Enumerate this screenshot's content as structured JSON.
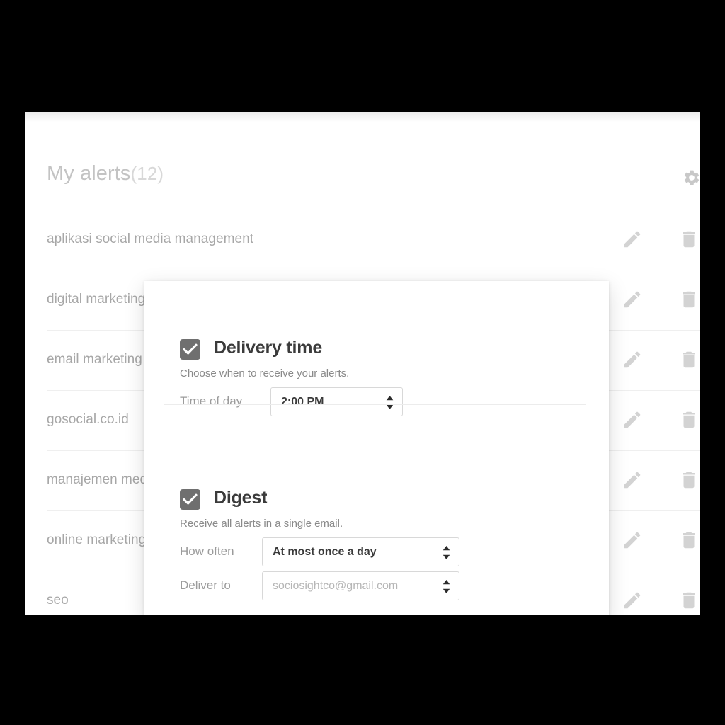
{
  "page": {
    "title_main": "My alerts",
    "title_count": "(12)",
    "settings_icon": "gear-icon",
    "edit_icon": "pencil-icon",
    "delete_icon": "trash-icon"
  },
  "alerts": [
    {
      "name": "aplikasi social media management"
    },
    {
      "name": "digital marketing"
    },
    {
      "name": "email marketing"
    },
    {
      "name": "gosocial.co.id"
    },
    {
      "name": "manajemen media sosial"
    },
    {
      "name": "online marketing"
    },
    {
      "name": "seo"
    }
  ],
  "modal": {
    "delivery_time": {
      "title": "Delivery time",
      "description": "Choose when to receive your alerts.",
      "checked": true,
      "field_label": "Time of day",
      "value": "2:00 PM"
    },
    "digest": {
      "title": "Digest",
      "description": "Receive all alerts in a single email.",
      "checked": true,
      "how_often_label": "How often",
      "how_often_value": "At most once a day",
      "deliver_to_label": "Deliver to",
      "deliver_to_value": "sociosightco@gmail.com"
    }
  },
  "colors": {
    "checkbox": "#6f6f6f",
    "title_text": "#3b3b3b",
    "muted_text": "#9e9e9e",
    "border": "#d8d8d8",
    "divider": "#ececec"
  }
}
